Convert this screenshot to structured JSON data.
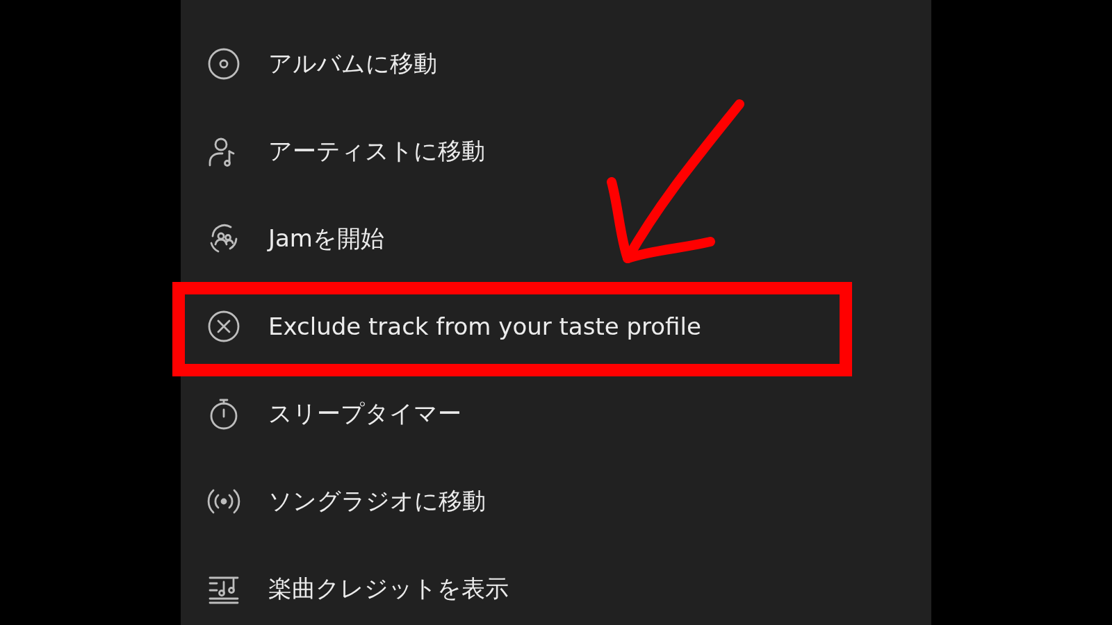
{
  "menu": {
    "items": [
      {
        "kind": "disc",
        "label": "アルバムに移動",
        "highlighted": false
      },
      {
        "kind": "artist",
        "label": "アーティストに移動",
        "highlighted": false
      },
      {
        "kind": "jam",
        "label": "Jamを開始",
        "highlighted": false
      },
      {
        "kind": "exclude",
        "label": "Exclude track from your taste profile",
        "highlighted": true
      },
      {
        "kind": "timer",
        "label": "スリープタイマー",
        "highlighted": false
      },
      {
        "kind": "radio",
        "label": "ソングラジオに移動",
        "highlighted": false
      },
      {
        "kind": "credits",
        "label": "楽曲クレジットを表示",
        "highlighted": false
      }
    ]
  }
}
